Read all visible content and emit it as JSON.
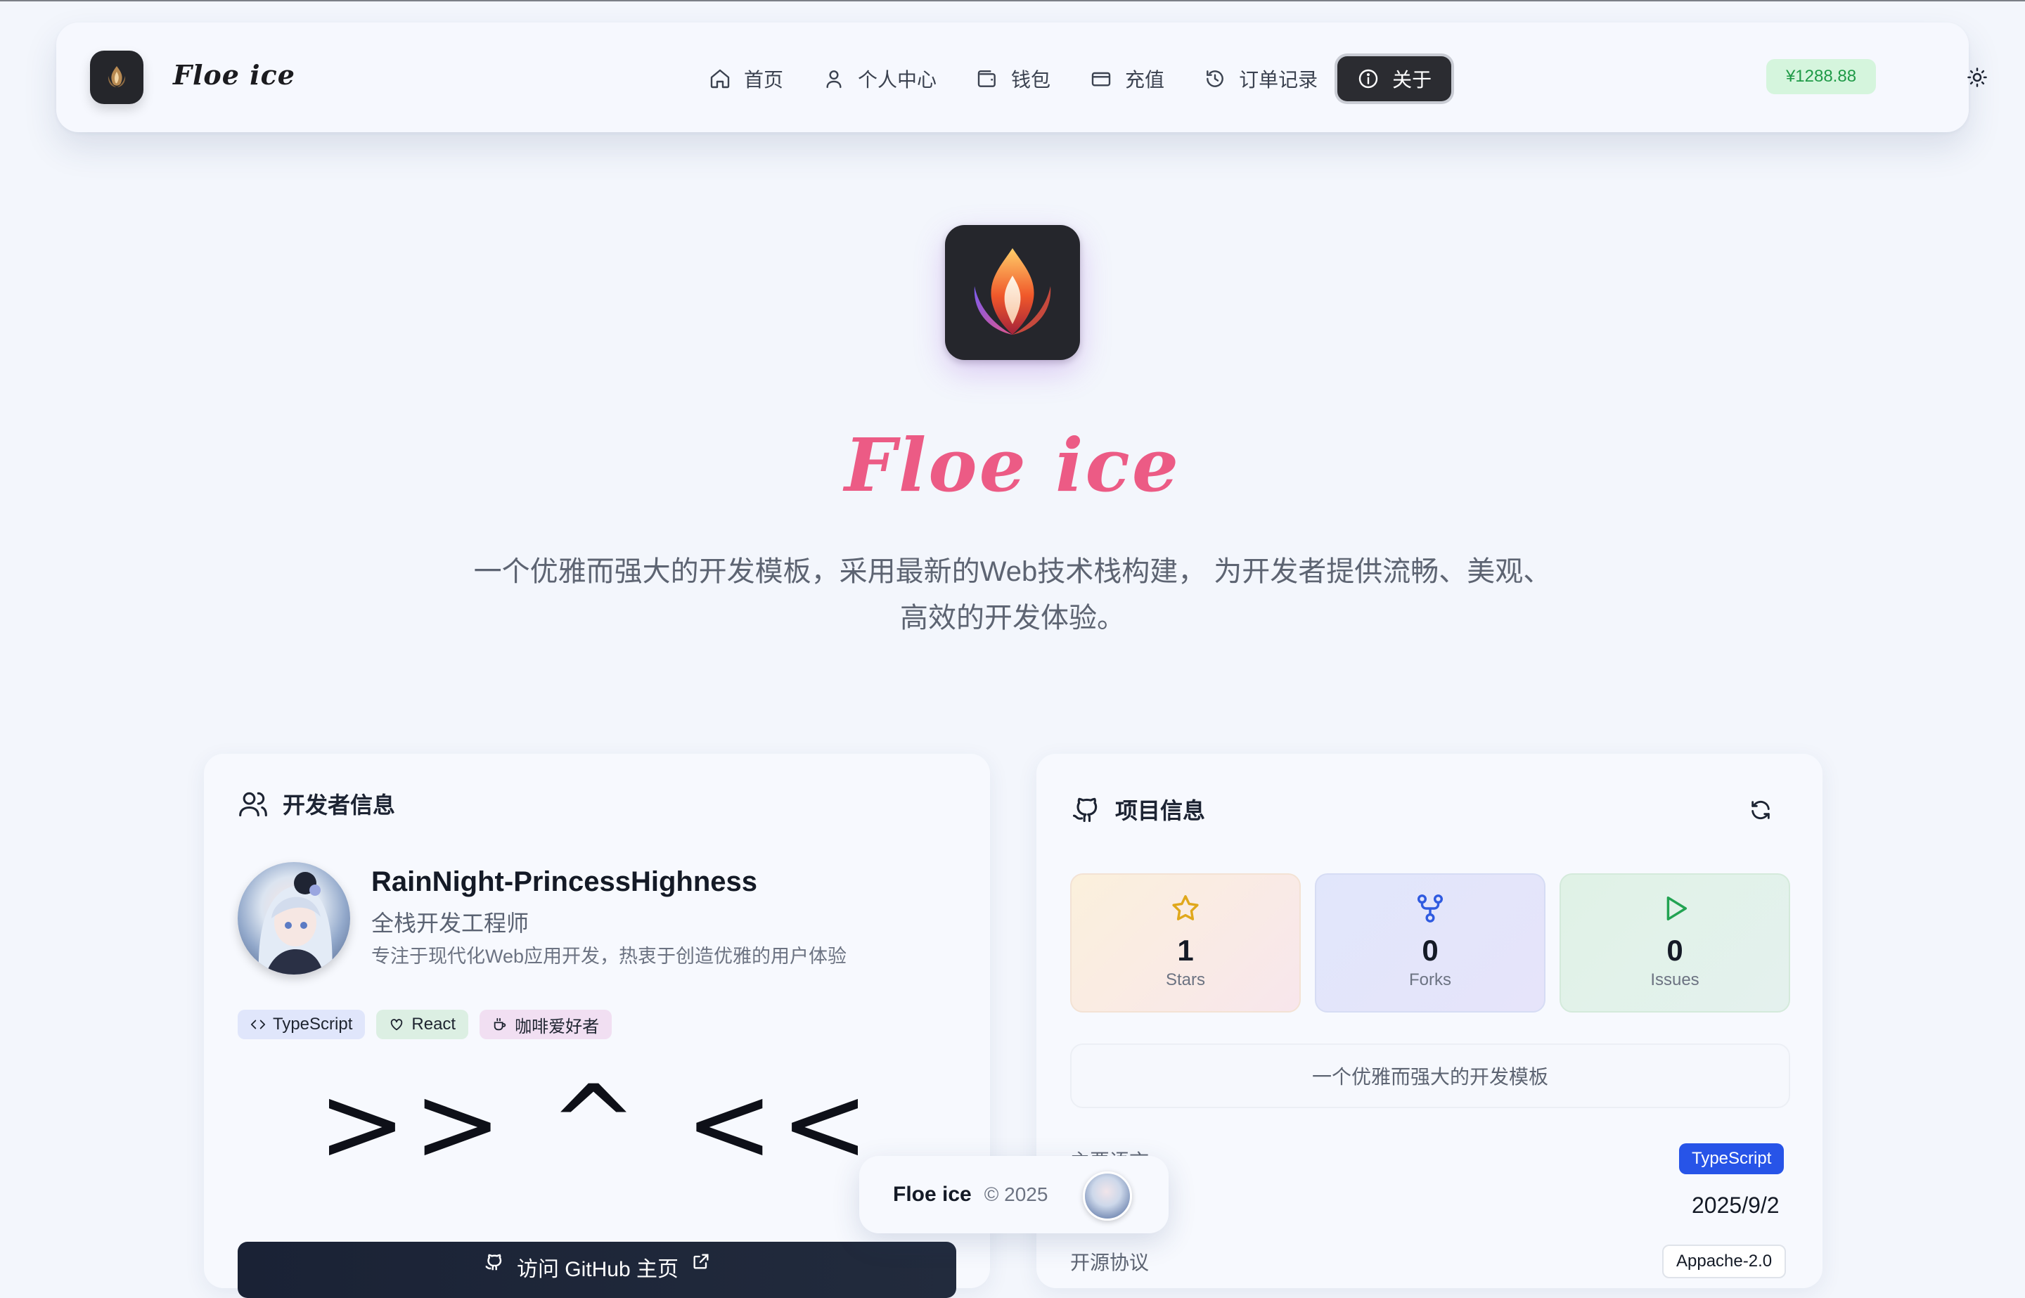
{
  "nav": {
    "brand": "Floe ice",
    "items": [
      {
        "label": "首页",
        "icon": "home-icon"
      },
      {
        "label": "个人中心",
        "icon": "user-icon"
      },
      {
        "label": "钱包",
        "icon": "wallet-icon"
      },
      {
        "label": "充值",
        "icon": "credit-card-icon"
      },
      {
        "label": "订单记录",
        "icon": "history-icon"
      },
      {
        "label": "关于",
        "icon": "info-icon",
        "active": true
      }
    ],
    "balance": "¥1288.88",
    "theme_icon": "sun-icon"
  },
  "hero": {
    "title": "Floe ice",
    "description_line1": "一个优雅而强大的开发模板，采用最新的Web技术栈构建， 为开发者提供流畅、美观、",
    "description_line2": "高效的开发体验。"
  },
  "developer": {
    "heading": "开发者信息",
    "name": "RainNight-PrincessHighness",
    "role": "全栈开发工程师",
    "bio": "专注于现代化Web应用开发，热衷于创造优雅的用户体验",
    "tags": [
      {
        "label": "TypeScript",
        "icon": "code-icon"
      },
      {
        "label": "React",
        "icon": "heart-icon"
      },
      {
        "label": "咖啡爱好者",
        "icon": "coffee-icon"
      }
    ],
    "kaomoji": ">> ^ <<",
    "github_button": "访问 GitHub 主页"
  },
  "project": {
    "heading": "项目信息",
    "stats": [
      {
        "value": "1",
        "label": "Stars"
      },
      {
        "value": "0",
        "label": "Forks"
      },
      {
        "value": "0",
        "label": "Issues"
      }
    ],
    "description": "一个优雅而强大的开发模板",
    "language_label": "主要语言",
    "language": "TypeScript",
    "date": "2025/9/2",
    "license_label": "开源协议",
    "license": "Appache-2.0"
  },
  "footer": {
    "brand": "Floe ice",
    "copyright": "© 2025"
  },
  "colors": {
    "accent_pink": "#ec5b85",
    "balance_green": "#1f9a47",
    "language_blue": "#2754e8",
    "dark": "#25262b"
  }
}
